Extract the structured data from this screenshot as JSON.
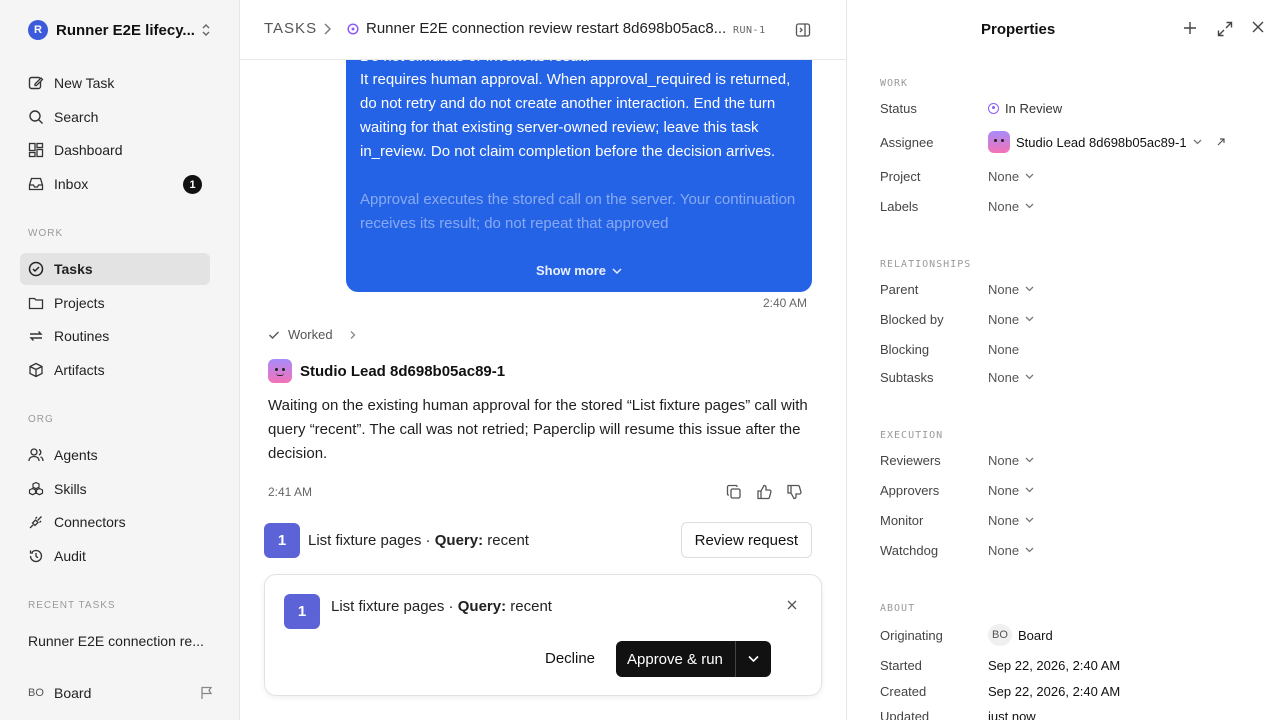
{
  "workspace": {
    "logo_letter": "R",
    "name": "Runner E2E lifecy..."
  },
  "nav": {
    "new_task": "New Task",
    "search": "Search",
    "dashboard": "Dashboard",
    "inbox": "Inbox",
    "inbox_count": "1"
  },
  "work_section": {
    "label": "WORK",
    "tasks": "Tasks",
    "projects": "Projects",
    "routines": "Routines",
    "artifacts": "Artifacts"
  },
  "org_section": {
    "label": "ORG",
    "agents": "Agents",
    "skills": "Skills",
    "connectors": "Connectors",
    "audit": "Audit"
  },
  "recent": {
    "label": "RECENT TASKS",
    "item": "Runner E2E connection re..."
  },
  "user": {
    "initials": "BO",
    "name": "Board"
  },
  "header": {
    "root": "TASKS",
    "title": "Runner E2E connection review restart 8d698b05ac8...",
    "task_id": "RUN-1"
  },
  "bubble": {
    "line1": "Do not simulate or invent its result.",
    "line2": "It requires human approval. When approval_required is returned, do not retry and do not create another interaction. End the turn waiting for that existing server-owned review; leave this task in_review. Do not claim completion before the decision arrives.",
    "line3": "Approval executes the stored call on the server. Your continuation receives its result; do not repeat that approved",
    "show_more": "Show more",
    "time": "2:40 AM"
  },
  "reply": {
    "worked": "Worked",
    "agent": "Studio Lead 8d698b05ac89-1",
    "text": "Waiting on the existing human approval for the stored “List fixture pages” call with query “recent”. The call was not retried; Paperclip will resume this issue after the decision.",
    "time": "2:41 AM"
  },
  "call": {
    "index": "1",
    "name": "List fixture pages · ",
    "query_key": "Query:",
    "query_value": " recent",
    "review_button": "Review request"
  },
  "approval": {
    "index": "1",
    "name": "List fixture pages · ",
    "query_key": "Query:",
    "query_value": " recent",
    "decline": "Decline",
    "approve": "Approve & run"
  },
  "props": {
    "title": "Properties",
    "work_label": "WORK",
    "status_key": "Status",
    "status_val": "In Review",
    "assignee_key": "Assignee",
    "assignee_val": "Studio Lead 8d698b05ac89-1",
    "project_key": "Project",
    "project_val": "None",
    "labels_key": "Labels",
    "labels_val": "None",
    "rel_label": "RELATIONSHIPS",
    "parent_key": "Parent",
    "parent_val": "None",
    "blocked_key": "Blocked by",
    "blocked_val": "None",
    "blocking_key": "Blocking",
    "blocking_val": "None",
    "subtasks_key": "Subtasks",
    "subtasks_val": "None",
    "exec_label": "EXECUTION",
    "reviewers_key": "Reviewers",
    "reviewers_val": "None",
    "approvers_key": "Approvers",
    "approvers_val": "None",
    "monitor_key": "Monitor",
    "monitor_val": "None",
    "watchdog_key": "Watchdog",
    "watchdog_val": "None",
    "about_label": "ABOUT",
    "originating_key": "Originating",
    "originating_initials": "BO",
    "originating_val": "Board",
    "started_key": "Started",
    "started_val": "Sep 22, 2026, 2:40 AM",
    "created_key": "Created",
    "created_val": "Sep 22, 2026, 2:40 AM",
    "updated_key": "Updated",
    "updated_val": "just now"
  },
  "colors": {
    "accent": "#2563e6",
    "call_index": "#5b63d6",
    "status_in_review": "#8b5cf6"
  }
}
